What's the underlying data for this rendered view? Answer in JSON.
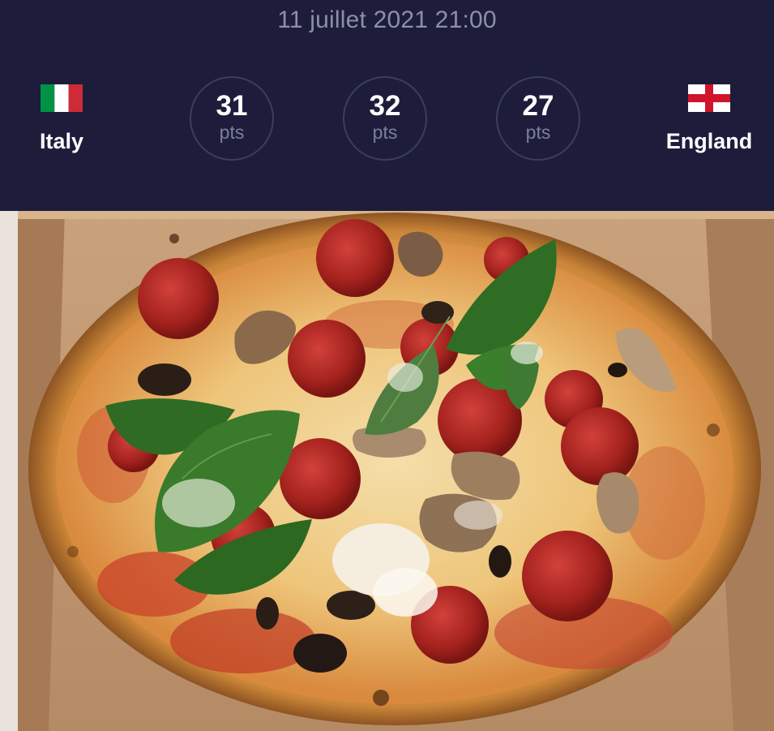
{
  "header": {
    "date": "11 juillet 2021 21:00",
    "home_team": {
      "name": "Italy",
      "flag": "italy-flag-icon"
    },
    "away_team": {
      "name": "England",
      "flag": "england-flag-icon"
    },
    "scores": [
      {
        "value": "31",
        "unit": "pts"
      },
      {
        "value": "32",
        "unit": "pts"
      },
      {
        "value": "27",
        "unit": "pts"
      }
    ]
  },
  "colors": {
    "header_bg": "#1d1d3b",
    "date_text": "#8d8fa6",
    "circle_border": "#3b3d5c",
    "italy_green": "#009246",
    "italy_white": "#ffffff",
    "italy_red": "#ce2b37",
    "england_red": "#cf142b"
  }
}
